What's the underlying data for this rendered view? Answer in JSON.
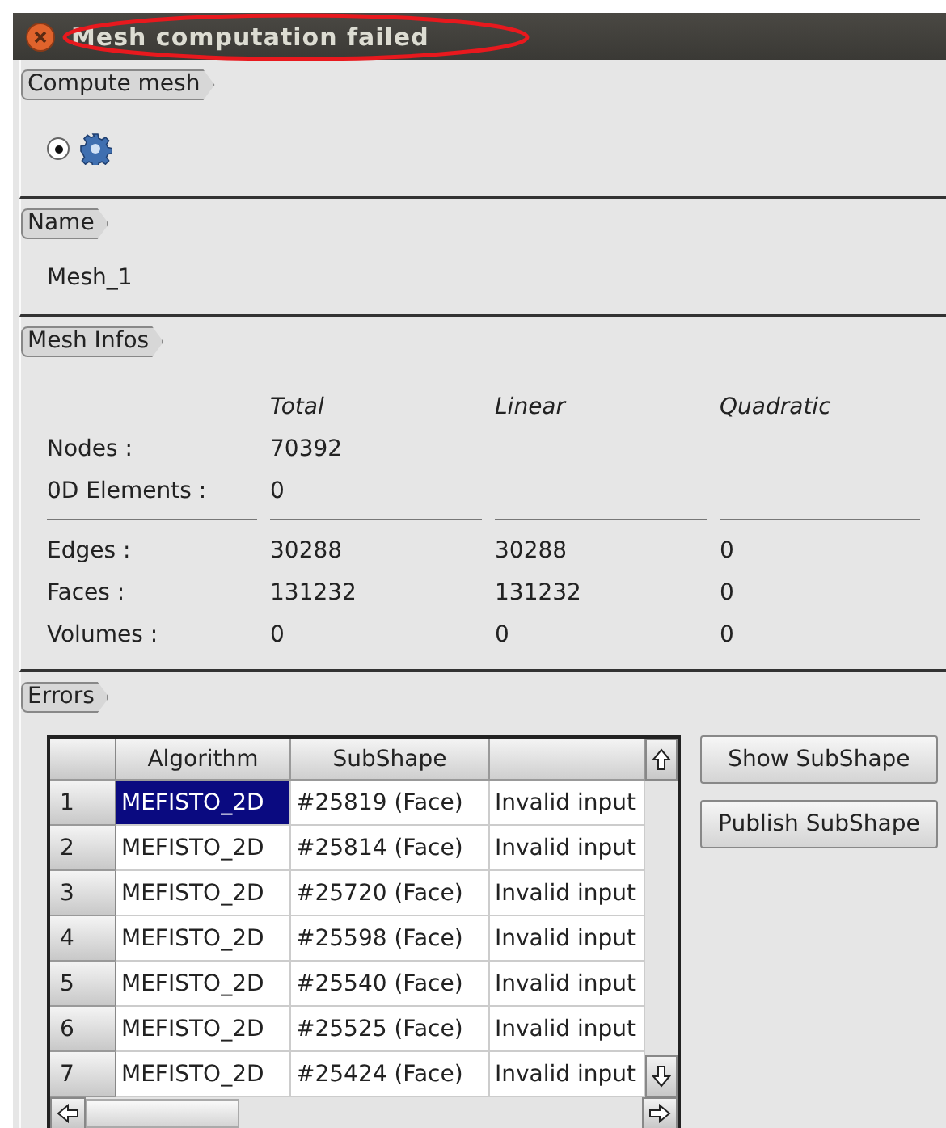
{
  "window": {
    "title": "Mesh computation failed",
    "title_circled": true
  },
  "compute_mesh": {
    "label": "Compute mesh",
    "radio_checked": true
  },
  "name_section": {
    "label": "Name",
    "value": "Mesh_1"
  },
  "mesh_infos": {
    "label": "Mesh Infos",
    "columns": [
      "Total",
      "Linear",
      "Quadratic"
    ],
    "rows_top": [
      {
        "label": "Nodes :",
        "values": [
          "70392"
        ]
      },
      {
        "label": "0D Elements :",
        "values": [
          "0"
        ]
      }
    ],
    "rows_bottom": [
      {
        "label": "Edges :",
        "values": [
          "30288",
          "30288",
          "0"
        ]
      },
      {
        "label": "Faces :",
        "values": [
          "131232",
          "131232",
          "0"
        ]
      },
      {
        "label": "Volumes :",
        "values": [
          "0",
          "0",
          "0"
        ]
      }
    ]
  },
  "errors": {
    "label": "Errors",
    "columns": [
      "Algorithm",
      "SubShape"
    ],
    "rows": [
      {
        "number": "1",
        "algorithm": "MEFISTO_2D",
        "subshape": "#25819 (Face)",
        "column_3": "Invalid input",
        "selected": true
      },
      {
        "number": "2",
        "algorithm": "MEFISTO_2D",
        "subshape": "#25814 (Face)",
        "column_3": "Invalid input",
        "selected": false
      },
      {
        "number": "3",
        "algorithm": "MEFISTO_2D",
        "subshape": "#25720 (Face)",
        "column_3": "Invalid input",
        "selected": false
      },
      {
        "number": "4",
        "algorithm": "MEFISTO_2D",
        "subshape": "#25598 (Face)",
        "column_3": "Invalid input",
        "selected": false
      },
      {
        "number": "5",
        "algorithm": "MEFISTO_2D",
        "subshape": "#25540 (Face)",
        "column_3": "Invalid input",
        "selected": false
      },
      {
        "number": "6",
        "algorithm": "MEFISTO_2D",
        "subshape": "#25525 (Face)",
        "column_3": "Invalid input",
        "selected": false
      },
      {
        "number": "7",
        "algorithm": "MEFISTO_2D",
        "subshape": "#25424 (Face)",
        "column_3": "Invalid input",
        "selected": false
      }
    ],
    "buttons": [
      "Show SubShape",
      "Publish SubShape"
    ]
  }
}
